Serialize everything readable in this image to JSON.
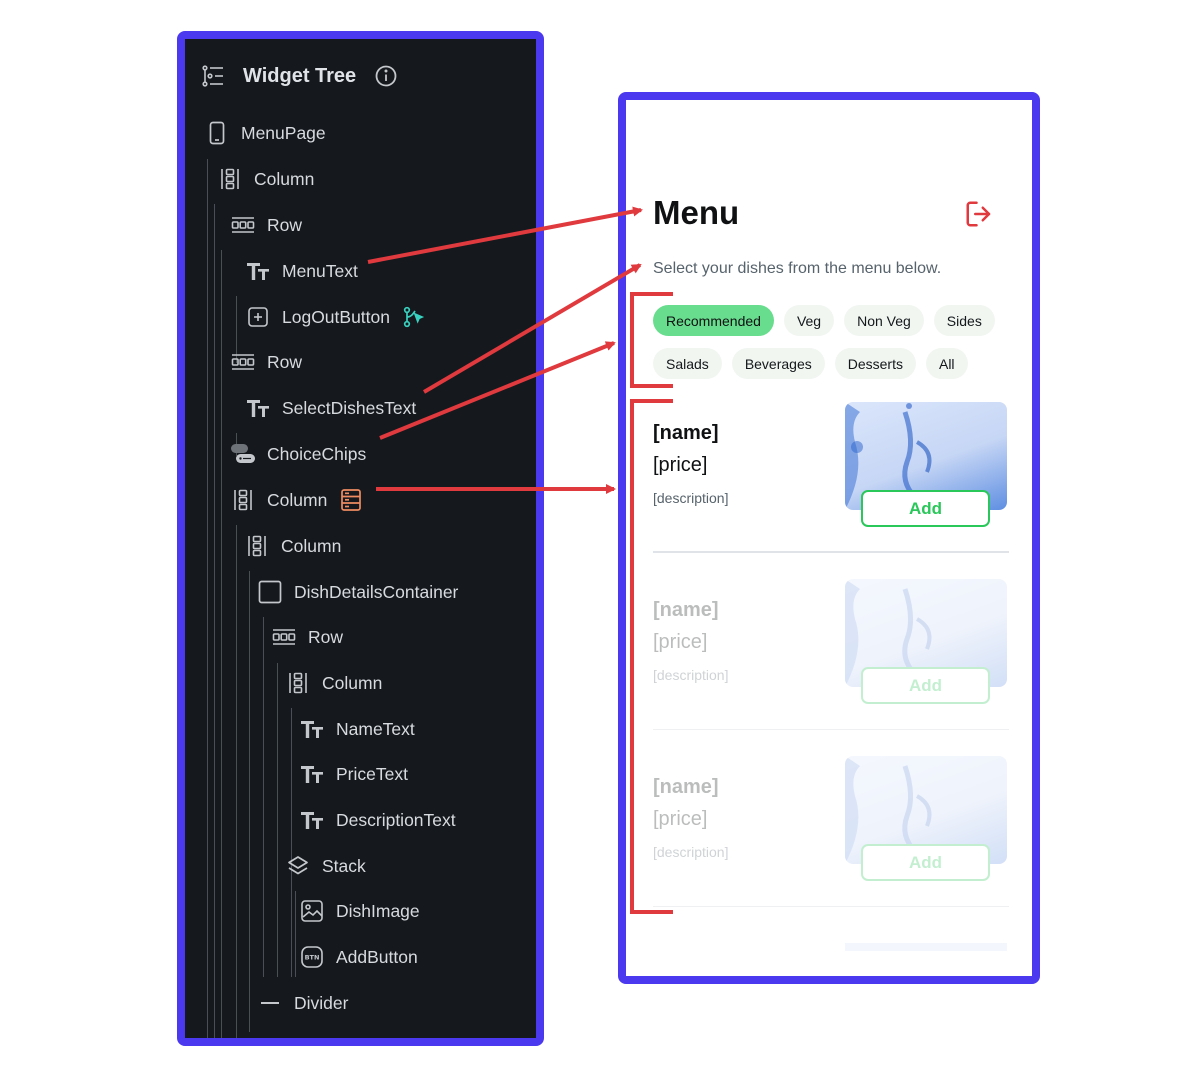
{
  "tree": {
    "title": "Widget Tree",
    "nodes": [
      {
        "label": "MenuPage",
        "icon": "phone-icon"
      },
      {
        "label": "Column",
        "icon": "column-icon"
      },
      {
        "label": "Row",
        "icon": "row-icon"
      },
      {
        "label": "MenuText",
        "icon": "text-icon"
      },
      {
        "label": "LogOutButton",
        "icon": "add-box-icon",
        "badge": "action-trigger-icon"
      },
      {
        "label": "Row",
        "icon": "row-icon"
      },
      {
        "label": "SelectDishesText",
        "icon": "text-icon"
      },
      {
        "label": "ChoiceChips",
        "icon": "choice-chips-icon"
      },
      {
        "label": "Column",
        "icon": "column-icon",
        "badge": "backend-query-icon"
      },
      {
        "label": "Column",
        "icon": "column-icon"
      },
      {
        "label": "DishDetailsContainer",
        "icon": "container-icon"
      },
      {
        "label": "Row",
        "icon": "row-icon"
      },
      {
        "label": "Column",
        "icon": "column-icon"
      },
      {
        "label": "NameText",
        "icon": "text-icon"
      },
      {
        "label": "PriceText",
        "icon": "text-icon"
      },
      {
        "label": "DescriptionText",
        "icon": "text-icon"
      },
      {
        "label": "Stack",
        "icon": "stack-icon"
      },
      {
        "label": "DishImage",
        "icon": "image-icon"
      },
      {
        "label": "AddButton",
        "icon": "button-icon"
      },
      {
        "label": "Divider",
        "icon": "divider-icon"
      }
    ]
  },
  "phone": {
    "title": "Menu",
    "subtitle": "Select your dishes from the menu below.",
    "chips_row1": [
      "Recommended",
      "Veg",
      "Non Veg",
      "Sides"
    ],
    "chips_row2": [
      "Salads",
      "Beverages",
      "Desserts",
      "All"
    ],
    "selected_chip": "Recommended",
    "dishes": [
      {
        "name": "[name]",
        "price": "[price]",
        "description": "[description]",
        "button": "Add"
      },
      {
        "name": "[name]",
        "price": "[price]",
        "description": "[description]",
        "button": "Add"
      },
      {
        "name": "[name]",
        "price": "[price]",
        "description": "[description]",
        "button": "Add"
      }
    ]
  },
  "colors": {
    "frame": "#4b39ef",
    "panel_bg": "#15181d",
    "arrow": "#e0393e",
    "chip_selected": "#68dd8e",
    "add_button": "#2ac75a",
    "logout_icon": "#e0393e",
    "action_badge": "#39d2c0",
    "query_badge": "#ee8b60"
  }
}
